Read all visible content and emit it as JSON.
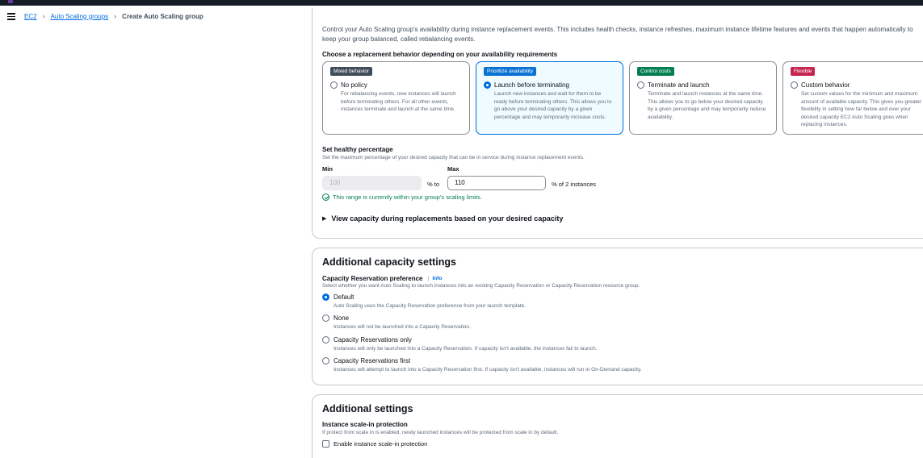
{
  "breadcrumb": {
    "items": [
      "EC2",
      "Auto Scaling groups"
    ],
    "current": "Create Auto Scaling group"
  },
  "replacement": {
    "intro": "Control your Auto Scaling group's availability during instance replacement events. This includes health checks, instance refreshes, maximum instance lifetime features and events that happen automatically to keep your group balanced, called rebalancing events.",
    "choose_label": "Choose a replacement behavior depending on your availability requirements",
    "tiles": [
      {
        "badge": "Mixed behavior",
        "badge_color": "#414d5c",
        "title": "No policy",
        "selected": false,
        "desc": "For rebalancing events, new instances will launch before terminating others. For all other events, instances terminate and launch at the same time."
      },
      {
        "badge": "Prioritize availability",
        "badge_color": "#0972d3",
        "title": "Launch before terminating",
        "selected": true,
        "desc": "Launch new instances and wait for them to be ready before terminating others. This allows you to go above your desired capacity by a given percentage and may temporarily increase costs."
      },
      {
        "badge": "Control costs",
        "badge_color": "#037f51",
        "title": "Terminate and launch",
        "selected": false,
        "desc": "Terminate and launch instances at the same time. This allows you to go below your desired capacity by a given percentage and may temporarily reduce availability."
      },
      {
        "badge": "Flexible",
        "badge_color": "#c7244f",
        "title": "Custom behavior",
        "selected": false,
        "desc": "Set custom values for the minimum and maximum amount of available capacity. This gives you greater flexibility in setting how far below and over your desired capacity EC2 Auto Scaling goes when replacing instances."
      }
    ]
  },
  "healthy": {
    "title": "Set healthy percentage",
    "desc": "Set the maximum percentage of your desired capacity that can be in service during instance replacement events.",
    "min_label": "Min",
    "max_label": "Max",
    "min_value": "100",
    "to_text": "% to",
    "max_value": "110",
    "of_text": "% of 2 instances",
    "success": "This range is currently within your group's scaling limits.",
    "expander": "View capacity during replacements based on your desired capacity"
  },
  "capacity": {
    "title": "Additional capacity settings",
    "pref_label": "Capacity Reservation preference",
    "info": "Info",
    "pref_desc": "Select whether you want Auto Scaling to launch instances into an existing Capacity Reservation or Capacity Reservation resource group.",
    "options": [
      {
        "label": "Default",
        "desc": "Auto Scaling uses the Capacity Reservation preference from your launch template.",
        "selected": true
      },
      {
        "label": "None",
        "desc": "Instances will not be launched into a Capacity Reservation.",
        "selected": false
      },
      {
        "label": "Capacity Reservations only",
        "desc": "Instances will only be launched into a Capacity Reservation. If capacity isn't available, the instances fail to launch.",
        "selected": false
      },
      {
        "label": "Capacity Reservations first",
        "desc": "Instances will attempt to launch into a Capacity Reservation first. If capacity isn't available, instances will run in On-Demand capacity.",
        "selected": false
      }
    ]
  },
  "additional": {
    "title": "Additional settings",
    "protection_label": "Instance scale-in protection",
    "protection_desc": "If protect from scale in is enabled, newly launched instances will be protected from scale in by default.",
    "checkbox_label": "Enable instance scale-in protection",
    "checked": false
  },
  "colors": {
    "link": "#006ce0",
    "success": "#037f51",
    "selected_tile_bg": "#f0fbff"
  }
}
